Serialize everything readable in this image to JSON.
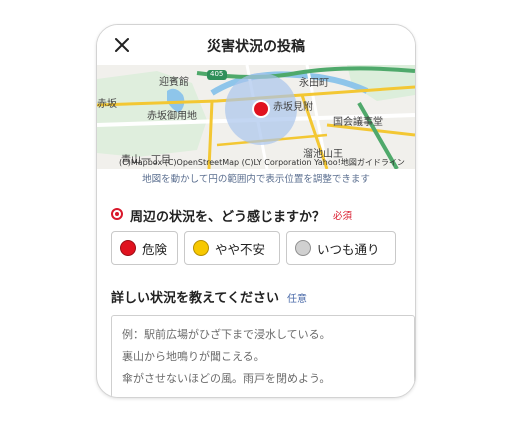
{
  "header": {
    "title": "災害状況の投稿",
    "close_icon": "close-icon"
  },
  "map": {
    "labels": {
      "geihinkan": "迎賓館",
      "nagatacho": "永田町",
      "akasaka": "赤坂",
      "akasaka_gyoen": "赤坂御用地",
      "akasaka_mitsuke": "赤坂見附",
      "kokkai": "国会議事堂",
      "aoyama": "青山一丁目",
      "tameike": "溜池山王",
      "route": "405"
    },
    "attribution": "(C)Mapbox (C)OpenStreetMap (C)LY Corporation Yahoo!地図ガイドライン",
    "hint": "地図を動かして円の範囲内で表示位置を調整できます"
  },
  "question": {
    "text": "周辺の状況を、どう感じますか？",
    "required": "必須",
    "options": [
      {
        "label": "危険",
        "color": "#e0121f"
      },
      {
        "label": "やや不安",
        "color": "#f7c800"
      },
      {
        "label": "いつも通り",
        "color": "#d0d0d0"
      }
    ]
  },
  "detail": {
    "label": "詳しい状況を教えてください",
    "optional": "任意",
    "placeholder_lines": [
      "例：駅前広場がひざ下まで浸水している。",
      "裏山から地鳴りが聞こえる。",
      "傘がさせないほどの風。雨戸を閉めよう。"
    ]
  },
  "colors": {
    "accent_red": "#d9182b",
    "hint_blue": "#5b6f90",
    "radius_circle": "#a9c4ec"
  }
}
